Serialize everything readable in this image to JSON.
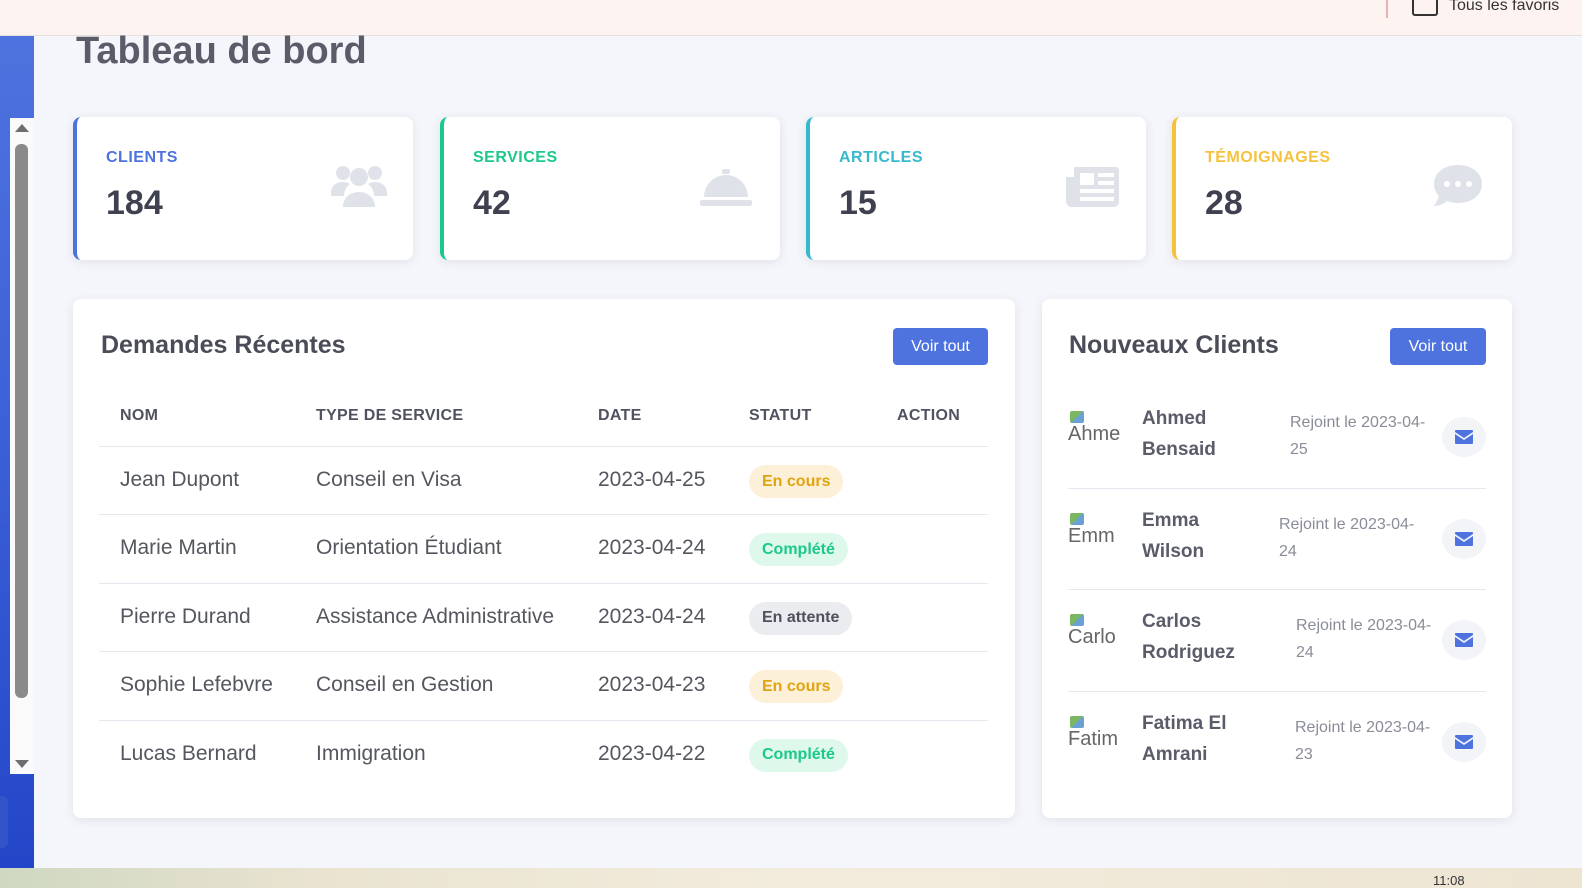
{
  "browser": {
    "bookmarks_folder_label": "Tous les favoris",
    "clock": "11:08"
  },
  "page": {
    "title": "Tableau de bord"
  },
  "colors": {
    "primary": "#4e73df",
    "success": "#1cc88a",
    "info": "#36b9cc",
    "warning": "#f6c23e"
  },
  "stats": [
    {
      "label": "CLIENTS",
      "value": "184",
      "icon": "users-icon",
      "color": "#4e73df"
    },
    {
      "label": "SERVICES",
      "value": "42",
      "icon": "concierge-bell-icon",
      "color": "#1cc88a"
    },
    {
      "label": "ARTICLES",
      "value": "15",
      "icon": "newspaper-icon",
      "color": "#36b9cc"
    },
    {
      "label": "TÉMOIGNAGES",
      "value": "28",
      "icon": "comment-dots-icon",
      "color": "#f6c23e"
    }
  ],
  "requests": {
    "title": "Demandes Récentes",
    "view_all_label": "Voir tout",
    "columns": [
      "NOM",
      "TYPE DE SERVICE",
      "DATE",
      "STATUT",
      "ACTION"
    ],
    "rows": [
      {
        "name": "Jean Dupont",
        "service": "Conseil en Visa",
        "date": "2023-04-25",
        "status": "En cours",
        "status_type": "en-cours"
      },
      {
        "name": "Marie Martin",
        "service": "Orientation Étudiant",
        "date": "2023-04-24",
        "status": "Complété",
        "status_type": "complete"
      },
      {
        "name": "Pierre Durand",
        "service": "Assistance Administrative",
        "date": "2023-04-24",
        "status": "En attente",
        "status_type": "attente"
      },
      {
        "name": "Sophie Lefebvre",
        "service": "Conseil en Gestion",
        "date": "2023-04-23",
        "status": "En cours",
        "status_type": "en-cours"
      },
      {
        "name": "Lucas Bernard",
        "service": "Immigration",
        "date": "2023-04-22",
        "status": "Complété",
        "status_type": "complete"
      }
    ]
  },
  "new_clients": {
    "title": "Nouveaux Clients",
    "view_all_label": "Voir tout",
    "items": [
      {
        "avatar_alt": "Ahme",
        "first": "Ahmed",
        "last": "Bensaid",
        "joined_line1": "Rejoint le 2023-04-",
        "joined_line2": "25"
      },
      {
        "avatar_alt": "Emm",
        "first": "Emma",
        "last": "Wilson",
        "joined_line1": "Rejoint le 2023-04-",
        "joined_line2": "24"
      },
      {
        "avatar_alt": "Carlo",
        "first": "Carlos",
        "last": "Rodriguez",
        "joined_line1": "Rejoint le 2023-04-",
        "joined_line2": "24"
      },
      {
        "avatar_alt": "Fatim",
        "first": "Fatima El",
        "last": "Amrani",
        "joined_line1": "Rejoint le 2023-04-",
        "joined_line2": "23"
      }
    ]
  }
}
